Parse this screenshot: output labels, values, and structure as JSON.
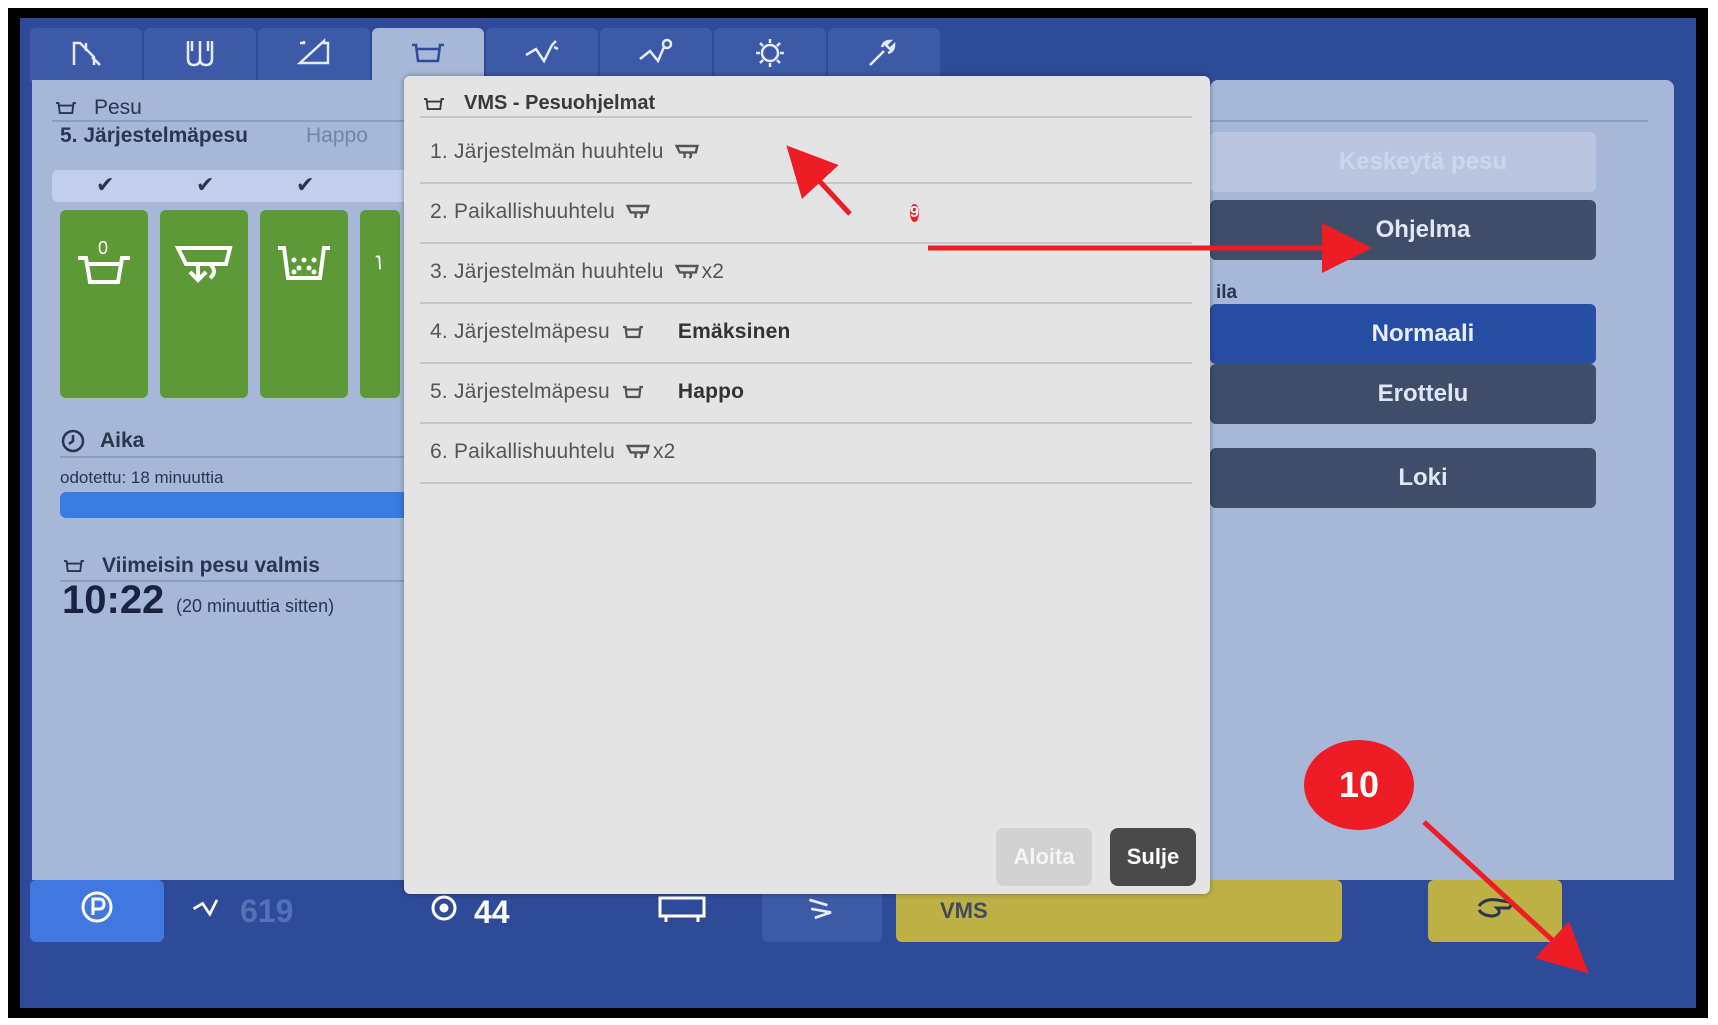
{
  "tabs": [
    {
      "icon": "cow-icon"
    },
    {
      "icon": "teats-icon"
    },
    {
      "icon": "box-icon"
    },
    {
      "icon": "wash-tub-icon",
      "active": true
    },
    {
      "icon": "robot-arm-icon"
    },
    {
      "icon": "robot-arm-alt-icon"
    },
    {
      "icon": "gear-icon"
    },
    {
      "icon": "wrench-icon"
    }
  ],
  "left": {
    "section_title": "Pesu",
    "current_program": "5. Järjestelmäpesu",
    "current_type": "Happo",
    "checks": [
      "✔",
      "✔",
      "✔"
    ],
    "steps": [
      {
        "icon": "tub-zero-icon",
        "label": "0"
      },
      {
        "icon": "rinse-icon"
      },
      {
        "icon": "wash-dots-icon"
      },
      {
        "icon": "partial-step-icon"
      }
    ],
    "time_title": "Aika",
    "expected": "odotettu: 18 minuuttia",
    "progress": 1.0,
    "last_title": "Viimeisin pesu valmis",
    "last_time": "10:22",
    "last_ago": "(20 minuuttia sitten)"
  },
  "right": {
    "stop_label": "Keskeytä pesu",
    "program_label": "Ohjelma",
    "tila_label": "ila",
    "normal_label": "Normaali",
    "separate_label": "Erottelu",
    "log_label": "Loki"
  },
  "modal": {
    "title": "VMS - Pesuohjelmat",
    "items": [
      {
        "text": "1. Järjestelmän huuhtelu",
        "icon": "rinse-icon",
        "suffix": "",
        "bold": ""
      },
      {
        "text": "2. Paikallishuuhtelu",
        "icon": "rinse-icon",
        "suffix": "",
        "bold": ""
      },
      {
        "text": "3. Järjestelmän huuhtelu",
        "icon": "rinse-icon",
        "suffix": "x2",
        "bold": ""
      },
      {
        "text": "4. Järjestelmäpesu",
        "icon": "wash-tub-icon",
        "suffix": "",
        "bold": "Emäksinen"
      },
      {
        "text": "5. Järjestelmäpesu",
        "icon": "wash-tub-icon",
        "suffix": "",
        "bold": "Happo"
      },
      {
        "text": "6. Paikallishuuhtelu",
        "icon": "rinse-icon",
        "suffix": "x2",
        "bold": ""
      }
    ],
    "start_label": "Aloita",
    "close_label": "Sulje"
  },
  "bottom": {
    "parking_icon": "parking-icon",
    "robot_value": "619",
    "counter_value": "44",
    "vms_label": "VMS",
    "hand_icon": "hand-icon"
  },
  "callouts": {
    "c9": "9",
    "c10": "10"
  },
  "colors": {
    "background_blue": "#2f4a99",
    "panel": "#a7b7d7",
    "step_green": "#5d9a37",
    "progress_blue": "#3a7be0",
    "yellow": "#bdb044",
    "callout_red": "#ee1c24"
  }
}
